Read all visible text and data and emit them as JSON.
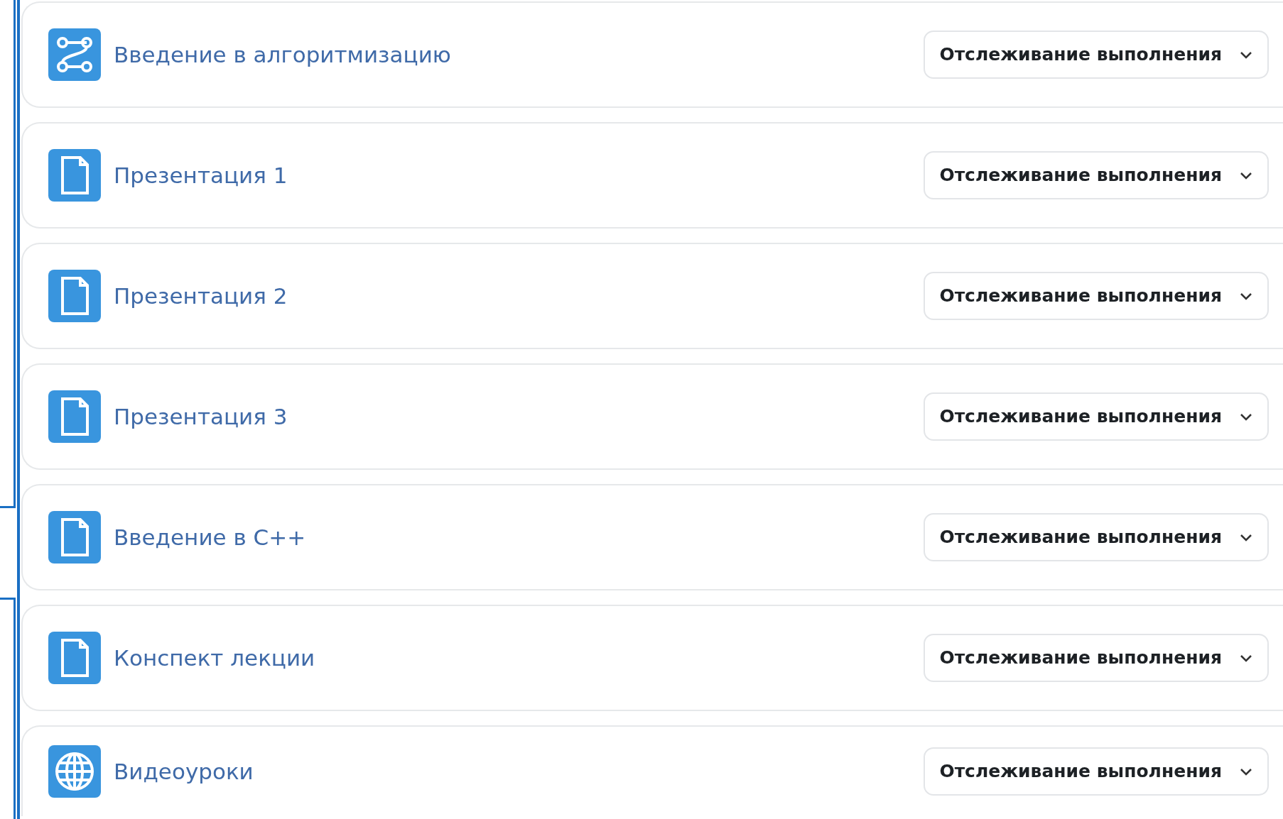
{
  "activities": [
    {
      "kind": "flow",
      "title": "Введение в алгоритмизацию",
      "completion_button": "Отслеживание выполнения"
    },
    {
      "kind": "file",
      "title": "Презентация 1",
      "completion_button": "Отслеживание выполнения"
    },
    {
      "kind": "file",
      "title": "Презентация 2",
      "completion_button": "Отслеживание выполнения"
    },
    {
      "kind": "file",
      "title": "Презентация 3",
      "completion_button": "Отслеживание выполнения"
    },
    {
      "kind": "file",
      "title": "Введение в C++",
      "completion_button": "Отслеживание выполнения"
    },
    {
      "kind": "file",
      "title": "Конспект лекции",
      "completion_button": "Отслеживание выполнения"
    },
    {
      "kind": "globe",
      "title": "Видеоуроки",
      "completion_button": "Отслеживание выполнения"
    }
  ]
}
